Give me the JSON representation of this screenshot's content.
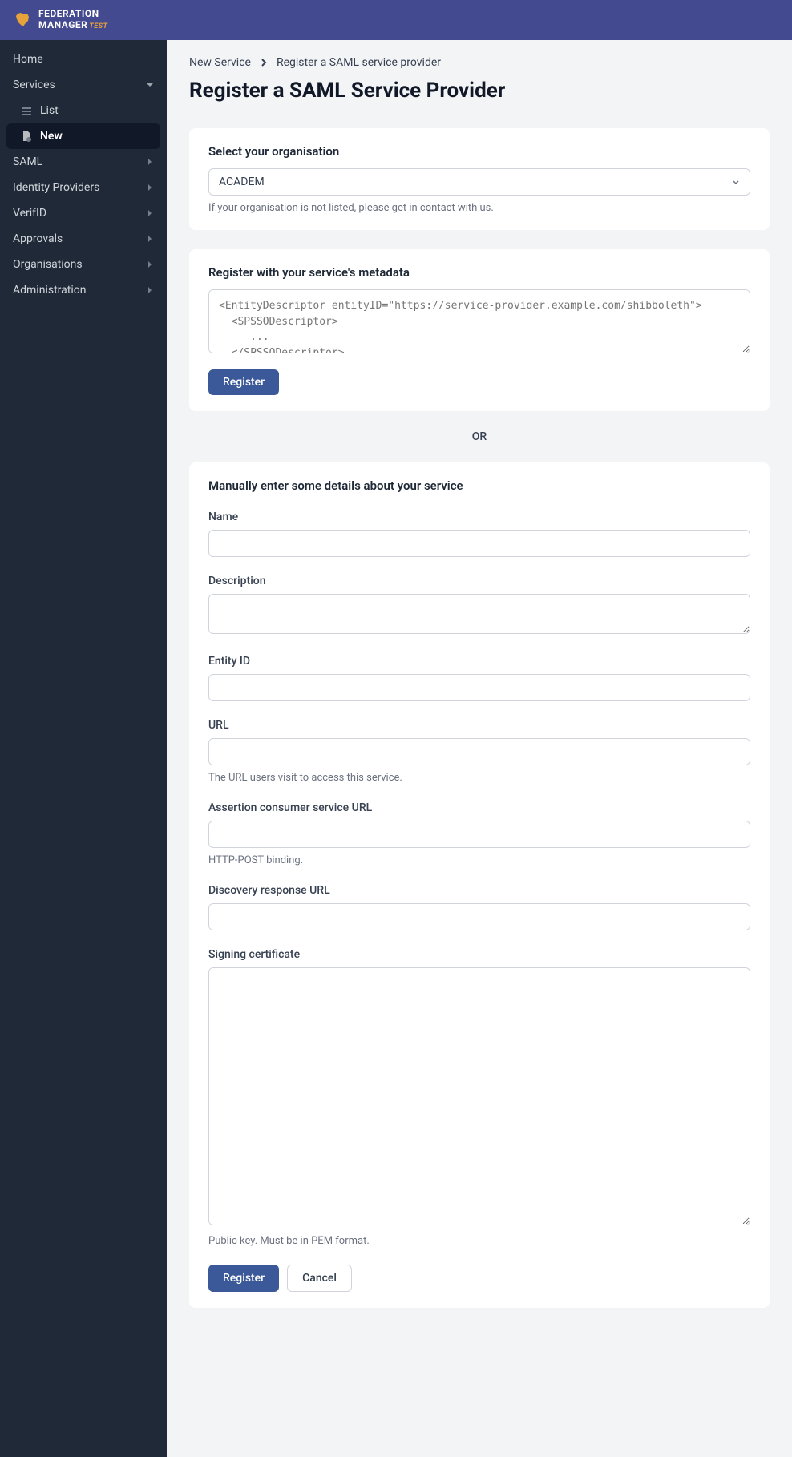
{
  "header": {
    "logo_line1": "FEDERATION",
    "logo_line2": "MANAGER",
    "logo_sub": "TEST"
  },
  "sidebar": {
    "home": "Home",
    "services": "Services",
    "list": "List",
    "new": "New",
    "saml": "SAML",
    "identity_providers": "Identity Providers",
    "verifid": "VerifID",
    "approvals": "Approvals",
    "organisations": "Organisations",
    "administration": "Administration"
  },
  "breadcrumb": {
    "item1": "New Service",
    "item2": "Register a SAML service provider"
  },
  "page_title": "Register a SAML Service Provider",
  "org_section": {
    "title": "Select your organisation",
    "selected": "ACADEM",
    "help": "If your organisation is not listed, please get in contact with us."
  },
  "metadata_section": {
    "title": "Register with your service's metadata",
    "placeholder": "<EntityDescriptor entityID=\"https://service-provider.example.com/shibboleth\">\n  <SPSSODescriptor>\n     ...\n  </SPSSODescriptor>\n</EntityDescriptor>",
    "register_btn": "Register"
  },
  "or_text": "OR",
  "manual_section": {
    "title": "Manually enter some details about your service",
    "name_label": "Name",
    "description_label": "Description",
    "entity_id_label": "Entity ID",
    "url_label": "URL",
    "url_help": "The URL users visit to access this service.",
    "acs_label": "Assertion consumer service URL",
    "acs_help": "HTTP-POST binding.",
    "discovery_label": "Discovery response URL",
    "cert_label": "Signing certificate",
    "cert_help": "Public key. Must be in PEM format.",
    "register_btn": "Register",
    "cancel_btn": "Cancel"
  }
}
